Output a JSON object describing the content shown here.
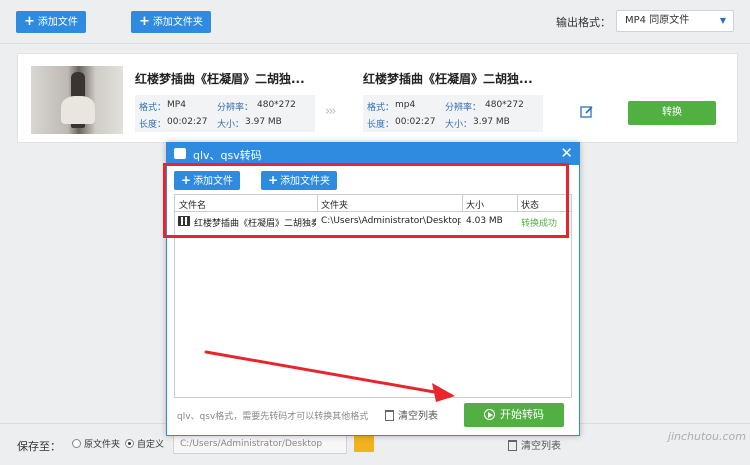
{
  "toolbar": {
    "add_file": "添加文件",
    "add_folder": "添加文件夹",
    "output_format_label": "输出格式：",
    "output_format_value": "MP4  同原文件"
  },
  "file_card": {
    "source": {
      "name": "红楼梦插曲《枉凝眉》二胡独...",
      "format_key": "格式：",
      "format": "MP4",
      "resolution_key": "分辨率：",
      "resolution": "480*272",
      "duration_key": "长度：",
      "duration": "00:02:27",
      "size_key": "大小：",
      "size": "3.97 MB"
    },
    "target": {
      "name": "红楼梦插曲《枉凝眉》二胡独...",
      "format_key": "格式：",
      "format": "mp4",
      "resolution_key": "分辨率：",
      "resolution": "480*272",
      "duration_key": "长度：",
      "duration": "00:02:27",
      "size_key": "大小：",
      "size": "3.97 MB"
    },
    "convert_label": "转换"
  },
  "dialog": {
    "title": "qlv、qsv转码",
    "add_file": "添加文件",
    "add_folder": "添加文件夹",
    "columns": [
      "文件名",
      "文件夹",
      "大小",
      "状态"
    ],
    "rows": [
      {
        "name": "红楼梦插曲《枉凝眉》二胡独奏",
        "folder": "C:\\Users\\Administrator\\Desktop",
        "size": "4.03 MB",
        "status": "转换成功"
      }
    ],
    "hint": "qlv、qsv格式，需要先转码才可以转换其他格式",
    "clear_label": "清空列表",
    "start_label": "开始转码",
    "close_glyph": "✕"
  },
  "bottom": {
    "save_to_label": "保存至：",
    "option_original": "原文件夹",
    "option_custom": "自定义",
    "path_value": "C:/Users/Administrator/Desktop",
    "clear_label": "清空列表",
    "watermark": "jinchutou.com"
  },
  "colors": {
    "accent_blue": "#2f8be0",
    "success_green": "#52b043",
    "highlight_red": "#e8242d"
  }
}
